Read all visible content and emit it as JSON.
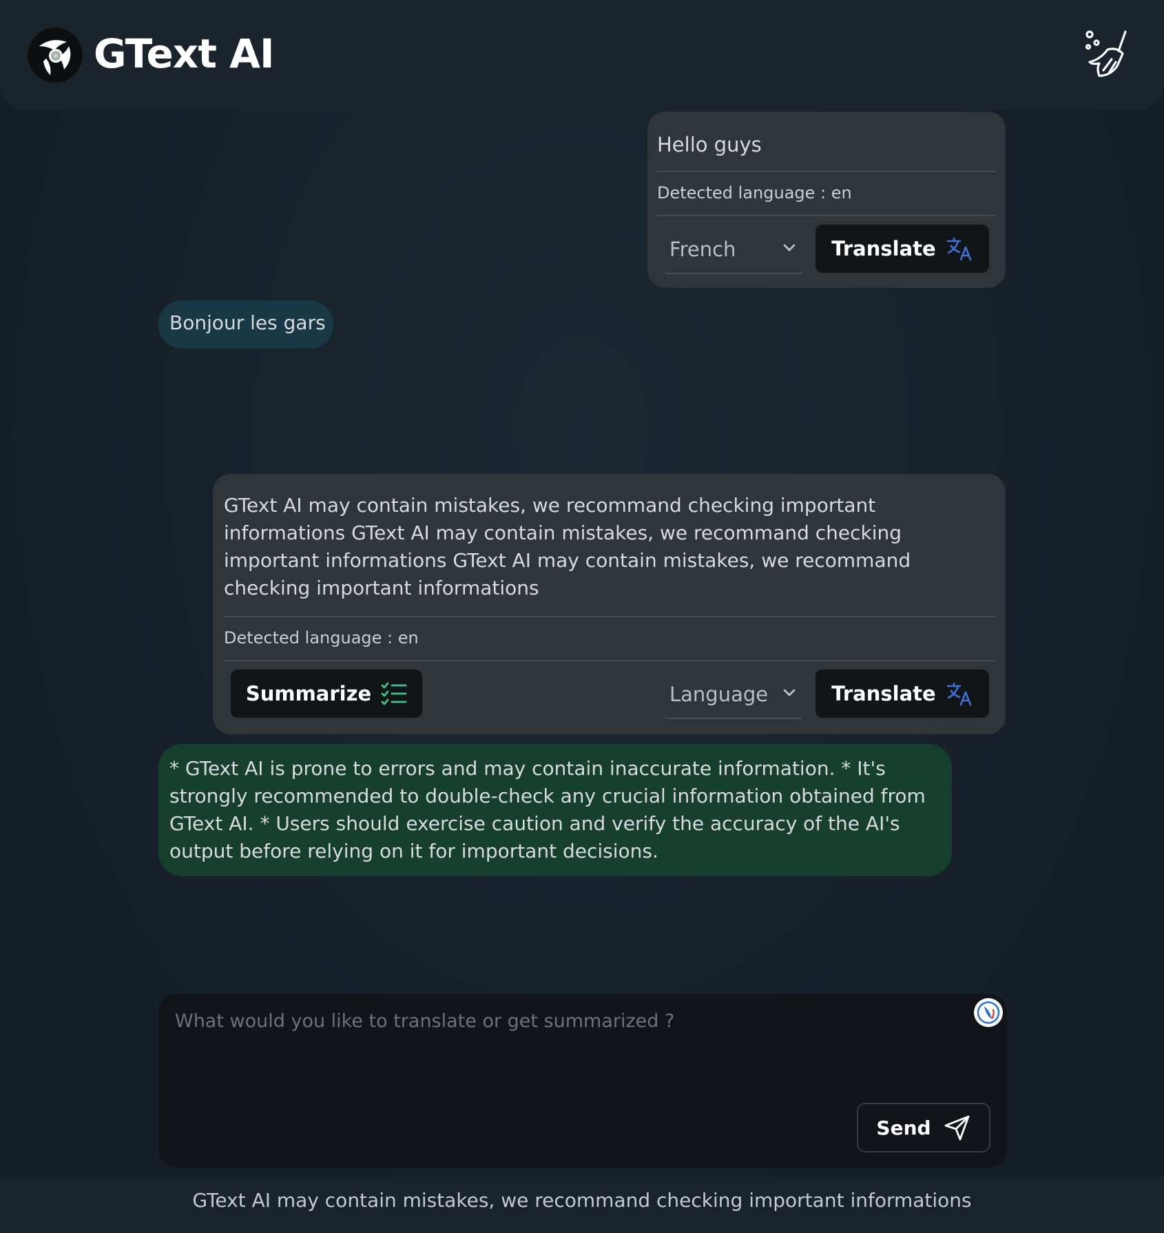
{
  "header": {
    "title": "GText AI",
    "logo_icon": "gtext-logo-icon",
    "clear_icon": "broom-icon"
  },
  "messages": {
    "first": {
      "text": "Hello guys",
      "detected_language": "Detected language : en",
      "language_select": "French",
      "translate_label": "Translate"
    },
    "first_result": {
      "text": "Bonjour les gars"
    },
    "second": {
      "text": "GText AI may contain mistakes, we recommand checking important informations GText AI may contain mistakes, we recommand checking important informations GText AI may contain mistakes, we recommand checking important informations",
      "detected_language": "Detected language : en",
      "summarize_label": "Summarize",
      "language_select": "Language",
      "translate_label": "Translate"
    },
    "second_result": {
      "text": "* GText AI is prone to errors and may contain inaccurate information. * It's strongly recommended to double-check any crucial information obtained from GText AI. * Users should exercise caution and verify the accuracy of the AI's output before relying on it for important decisions."
    }
  },
  "composer": {
    "placeholder": "What would you like to translate or get summarized ?",
    "value": "",
    "send_label": "Send"
  },
  "footer": {
    "disclaimer": "GText AI may contain mistakes, we recommand checking important informations"
  },
  "colors": {
    "accent_blue": "#3b73d6",
    "accent_green": "#3ec98a",
    "translation_bubble": "#173844",
    "summary_bubble": "#163f2e"
  }
}
